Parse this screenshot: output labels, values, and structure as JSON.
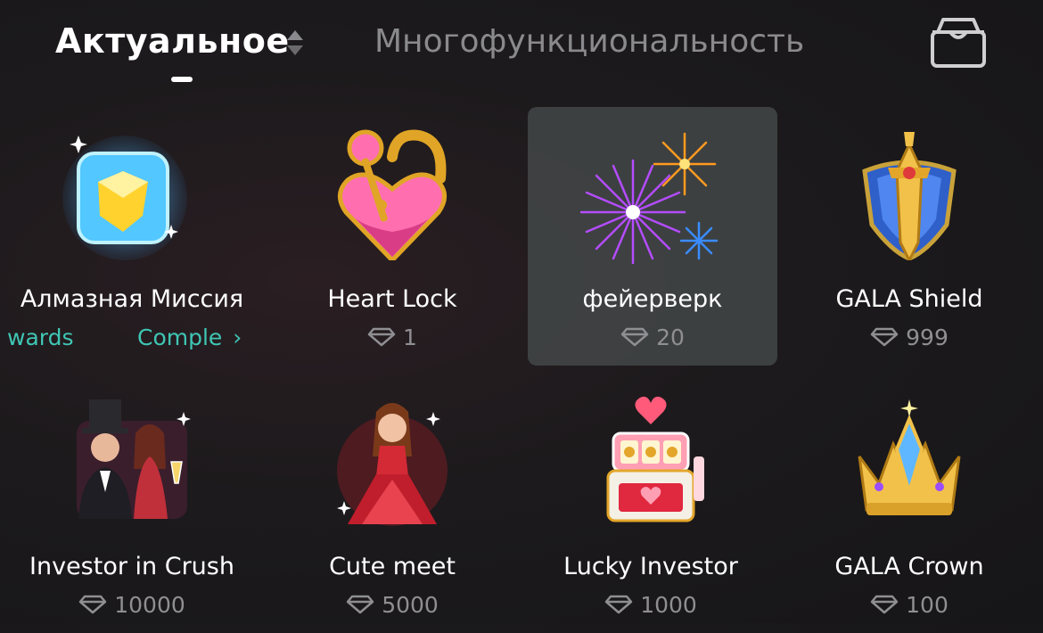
{
  "tabs": {
    "active": "Актуальное",
    "inactive": "Многофункциональность"
  },
  "icons": {
    "sort": "sort-updown-icon",
    "bag": "gift-box-icon",
    "price": "diamond-icon"
  },
  "colors": {
    "accent_teal": "#3fc6b4",
    "selected_bg": "#3f4646",
    "muted": "#8f8f93"
  },
  "gifts": [
    {
      "name": "Алмазная Миссия",
      "mission_left": "wards",
      "mission_right": "Comple",
      "mission_chevron": "›"
    },
    {
      "name": "Heart Lock",
      "price": "1"
    },
    {
      "name": "фейерверк",
      "price": "20"
    },
    {
      "name": "GALA Shield",
      "price": "999"
    },
    {
      "name": "Investor in Crush",
      "price": "10000"
    },
    {
      "name": "Cute meet",
      "price": "5000"
    },
    {
      "name": "Lucky Investor",
      "price": "1000"
    },
    {
      "name": "GALA Crown",
      "price": "100"
    }
  ]
}
